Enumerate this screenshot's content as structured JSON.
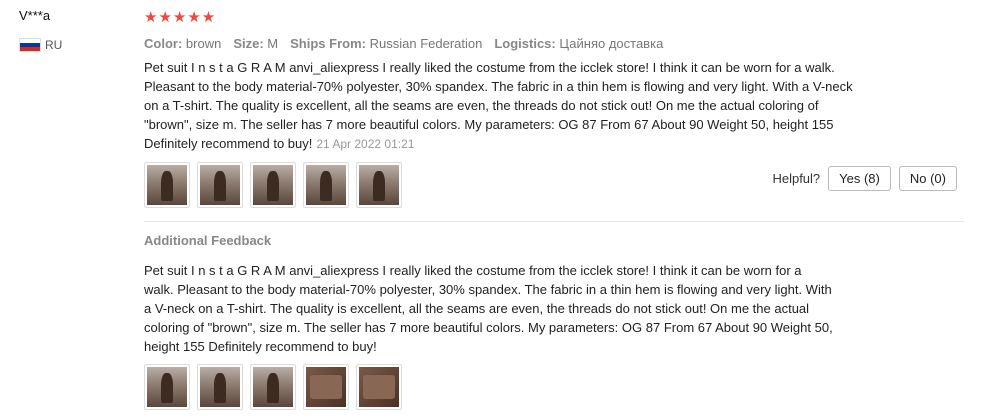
{
  "review": {
    "user": "V***a",
    "country": "RU",
    "flag_colors": [
      "#ffffff",
      "#0039a6",
      "#d52b1e"
    ],
    "rating": "★★★★★",
    "meta": [
      {
        "label": "Color:",
        "value": "brown"
      },
      {
        "label": "Size:",
        "value": "M"
      },
      {
        "label": "Ships From:",
        "value": "Russian Federation"
      },
      {
        "label": "Logistics:",
        "value": "Цайняо доставка"
      }
    ],
    "text": "Pet suit I n s t a G R A M anvi_aliexpress I really liked the costume from the icclek store! I think it can be worn for a walk. Pleasant to the body material-70% polyester, 30% spandex. The fabric in a thin hem is flowing and very light. With a V-neck on a T-shirt. The quality is excellent, all the seams are even, the threads do not stick out! On me the actual coloring of \"brown\", size m. The seller has 7 more beautiful colors. My parameters: OG 87 From 67 About 90 Weight 50, height 155 Definitely recommend to buy!",
    "date": "21 Apr 2022 01:21",
    "helpful_label": "Helpful?",
    "yes_label": "Yes (8)",
    "no_label": "No (0)"
  },
  "additional": {
    "title": "Additional Feedback",
    "text": "Pet suit I n s t a G R A M anvi_aliexpress I really liked the costume from the icclek store! I think it can be worn for a walk. Pleasant to the body material-70% polyester, 30% spandex. The fabric in a thin hem is flowing and very light. With a V-neck on a T-shirt. The quality is excellent, all the seams are even, the threads do not stick out! On me the actual coloring of \"brown\", size m. The seller has 7 more beautiful colors. My parameters: OG 87 From 67 About 90 Weight 50, height 155 Definitely recommend to buy!"
  }
}
